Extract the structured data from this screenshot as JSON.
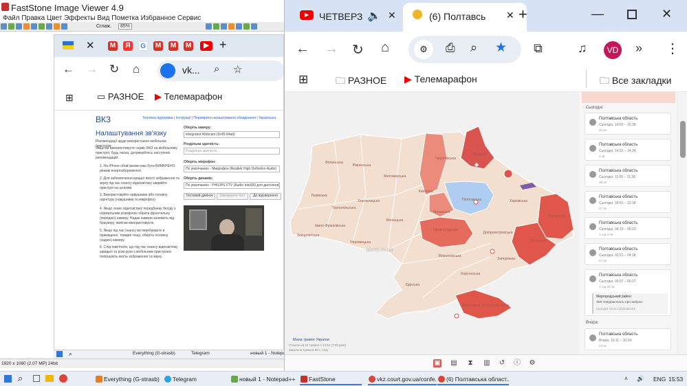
{
  "faststone": {
    "title": "FastStone Image Viewer 4.9",
    "menu": "Файл Правка Цвет Эффекты Вид Пометка Избранное Сервис",
    "smooth_label": "Сглаж.",
    "zoom": "85%",
    "status": "1920 x 1080 (2.07 MP)  24bit"
  },
  "inner_chrome": {
    "tabs": [
      "М",
      "Я",
      "G",
      "М",
      "М",
      "М"
    ],
    "address": "vk...",
    "bookmarks": [
      "РАЗНОЕ",
      "Телемарафон"
    ],
    "page": {
      "logo": "ВКЗ",
      "topnav": [
        "Технічна підтримка",
        "Інструкції",
        "Перевірити налаштування обладнання",
        "Українська"
      ],
      "title": "Налаштування зв'язку",
      "intro": "Рекомендації щодо використання мобільних пристроїв",
      "p1": "Якщо ви використовуєте сервіс ВКЗ на мобільному пристрої, будь ласка, дотримуйтесь наступних рекомендацій:",
      "steps": [
        "1. На iPhone обов'язково має бути ВИМКНЕНО режим енергозбереження.",
        "2. Для забезпечення кращої якості зображення та звуку під час сеансу відеозв'язку закрийте пристрої на штативі.",
        "3. Використовуйте навушники або головну гарнітуру (навушники та мікрофон).",
        "4. Якщо сеанс відеозв'язку передбачає бесіду з нормальним розмірною обрати фронтальну (передню) камеру. Надає камери залежить від браузеру, який ви використовуєте.",
        "5. Якщо під час сеансу ви перебуваєте в приміщенні, товарів тощо, оберіть основну (задню) камеру.",
        "6. Слід пам'ятати, що під час сеансу відеозв'язку швидкої та різкі рухи з мобільним пристроєм погіршують якість зображення та звуку."
      ],
      "camera_label": "Оберіть камеру:",
      "camera_value": "Integrated Webcam (0c45:64ad)",
      "resolution_label": "Роздільна здатність:",
      "resolution_value": "Роздільна здатність",
      "mic_label": "Оберіть мікрофон:",
      "mic_value": "По умолчанию - Микрофон (Realtek High Definition Audio)",
      "speaker_label": "Оберіть динамік:",
      "speaker_value": "По умолчанию - PHILIPS FTV (Audio Intel(R) для дисплеев)",
      "btn_test_call": "Тестовий дзвінок",
      "btn_test_sound": "Завершити тест",
      "btn_play": "До відтворення"
    }
  },
  "inner_taskbar": [
    "Everything (G-strasb)",
    "Telegram",
    "новый 1 - Notepad++"
  ],
  "browser": {
    "tab1_label": "ЧЕТВЕРЗ",
    "tab2_label": "(6) Полтавсь",
    "bookmarks": [
      "РАЗНОЕ",
      "Телемарафон",
      "Все закладки"
    ],
    "avatar": "VD"
  },
  "map": {
    "watermark": "alerts.in.ua",
    "legend_title": "Мапа тривог України",
    "legend_sub": "Станом на 22 травня о 13:52 (7:09 днів)",
    "legend_sub2": "Загальна тривога 00 с тому",
    "regions": [
      "Волинська",
      "Рівненська",
      "Житомирська",
      "Київська",
      "Чернігівська",
      "Сумська",
      "Полтавська",
      "Харківська",
      "Луганська",
      "Донецька",
      "Дніпропетровська",
      "Запорізька",
      "Херсонська",
      "Миколаївська",
      "Одеська",
      "Кіровоградська",
      "Черкаська",
      "Вінницька",
      "Хмельницька",
      "Тернопільська",
      "Львівська",
      "Закарпатська",
      "Івано-Франківська",
      "Чернівецька",
      "Автономна Республіка Крим"
    ]
  },
  "panel": {
    "section_today": "Сьогодні",
    "section_yesterday": "Вчора",
    "cards": [
      {
        "title": "Полтавська область",
        "sub": "Сьогодні, 14:55 – 15:38",
        "dur": "43 хв"
      },
      {
        "title": "Полтавська область",
        "sub": "Сьогодні, 14:31 – 14:34",
        "dur": "3 хв"
      },
      {
        "title": "Полтавська область",
        "sub": "Сьогодні, 11:00 – 11:38",
        "dur": "38 хв"
      },
      {
        "title": "Полтавська область",
        "sub": "Сьогодні, 09:51 – 10:18",
        "dur": "27 хв"
      },
      {
        "title": "Полтавська область",
        "sub": "Сьогодні, 04:19 – 05:23",
        "dur": "1 год 4 хв"
      },
      {
        "title": "Полтавська область",
        "sub": "Сьогодні, 03:21 – 04:18",
        "dur": "57 хв"
      },
      {
        "title": "Полтавська область",
        "sub": "Сьогодні, 00:07 – 00:27",
        "dur": "1 год 20 хв"
      }
    ],
    "news_title": "Миргородський район",
    "news_body": "ЗМІ повідомляють про вибухи.",
    "news_meta": "Сьогодні, 00:41 | @Ukraine24",
    "yesterday_card": {
      "title": "Полтавська область",
      "sub": "Вчора, 10:11 – 10:34",
      "dur": "23 хв"
    }
  },
  "taskbar": {
    "items": [
      "Everything (G-strasb)",
      "Telegram",
      "новый 1 - Notepad++",
      "FastStone",
      "vkz.court.gov.ua/confe...",
      "(6) Полтавська област..."
    ],
    "lang": "ENG",
    "time": "15:53"
  },
  "colors": {
    "alert": "#d9534f",
    "alert_light": "#ea8b7c",
    "calm": "#f2dfcf",
    "selected": "#aecdf0",
    "chrome_tab": "#d7e3f5"
  }
}
